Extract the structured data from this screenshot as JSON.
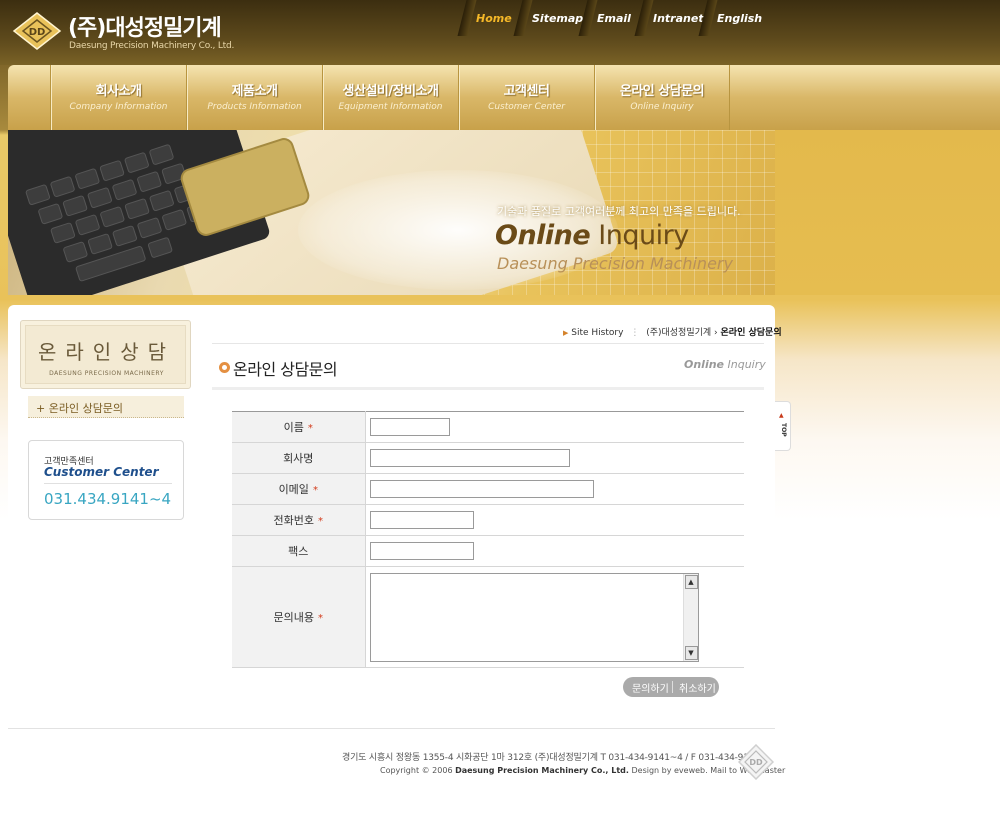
{
  "logo": {
    "company_ko": "(주)대성정밀기계",
    "company_en": "Daesung Precision Machinery Co., Ltd.",
    "mark_text": "DD"
  },
  "topnav": [
    {
      "label": "Home",
      "active": true
    },
    {
      "label": "Sitemap"
    },
    {
      "label": "Email"
    },
    {
      "label": "Intranet"
    },
    {
      "label": "English"
    }
  ],
  "mainmenu": [
    {
      "ko": "회사소개",
      "en": "Company Information"
    },
    {
      "ko": "제품소개",
      "en": "Products Information"
    },
    {
      "ko": "생산설비/장비소개",
      "en": "Equipment Information"
    },
    {
      "ko": "고객센터",
      "en": "Customer Center"
    },
    {
      "ko": "온라인 상담문의",
      "en": "Online Inquiry"
    }
  ],
  "banner": {
    "slogan": "기술과 품질로 고객여러분께 최고의 만족을 드립니다.",
    "title_bold": "Online",
    "title_rest": " Inquiry",
    "subtitle": "Daesung Precision Machinery"
  },
  "sidebar": {
    "title_ko": "온라인상담",
    "title_en": "DAESUNG PRECISION MACHINERY",
    "menu_item": "+ 온라인 상담문의",
    "cc_ko": "고객만족센터",
    "cc_en": "Customer Center",
    "cc_tel": "031.434.9141~4"
  },
  "breadcrumb": {
    "home": "Site History",
    "company": "(주)대성정밀기계",
    "current": "온라인 상담문의"
  },
  "page_title": "온라인 상담문의",
  "page_title_en_bold": "Online",
  "page_title_en_rest": " Inquiry",
  "form": {
    "fields": [
      {
        "label": "이름",
        "required": true
      },
      {
        "label": "회사명",
        "required": false
      },
      {
        "label": "이메일",
        "required": true
      },
      {
        "label": "전화번호",
        "required": true
      },
      {
        "label": "팩스",
        "required": false
      },
      {
        "label": "문의내용",
        "required": true
      }
    ],
    "required_mark": "*",
    "submit_label": "문의하기",
    "cancel_label": "취소하기"
  },
  "top_button": {
    "label": "TOP",
    "arrow": "▲"
  },
  "footer": {
    "address": "경기도 시흥시 정왕동 1355-4 시화공단 1마 312호 (주)대성정밀기계   T 031-434-9141~4 / F 031-434-9145",
    "copyright_prefix": "Copyright © 2006 ",
    "copyright_company": "Daesung Precision Machinery Co., Ltd.",
    "copyright_suffix": " Design by eveweb. Mail to Webmaster"
  },
  "colors": {
    "header_dark": "#4a3914",
    "accent_gold": "#e9c25a",
    "active_nav": "#f5b828",
    "required_red": "#d23a1a",
    "tel_blue": "#39a6c2"
  }
}
